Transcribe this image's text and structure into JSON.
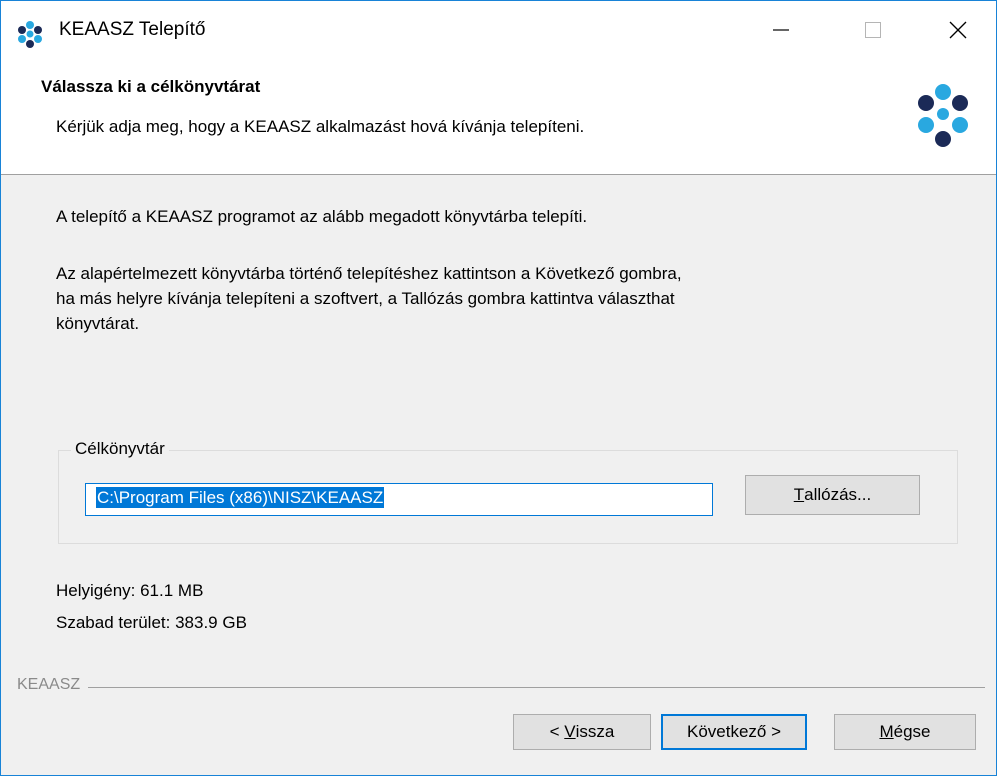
{
  "window": {
    "title": "KEAASZ Telepítő",
    "controls": {
      "minimize": "—",
      "maximize": "☐",
      "close": "✕"
    }
  },
  "header": {
    "title": "Válassza ki a célkönyvtárat",
    "subtitle": "Kérjük adja meg, hogy a KEAASZ alkalmazást hová kívánja telepíteni."
  },
  "body": {
    "paragraph1": "A telepítő a KEAASZ programot az alább megadott könyvtárba telepíti.",
    "paragraph2_line1": "Az alapértelmezett könyvtárba történő telepítéshez kattintson a Következő gombra,",
    "paragraph2_line2": "ha más helyre kívánja telepíteni a szoftvert, a Tallózás gombra kattintva választhat",
    "paragraph2_line3": "könyvtárat."
  },
  "destination": {
    "group_label": "Célkönyvtár",
    "path_value": "C:\\Program Files (x86)\\NISZ\\KEAASZ",
    "browse_prefix": "T",
    "browse_rest": "allózás..."
  },
  "space": {
    "required": "Helyigény: 61.1 MB",
    "free": "Szabad terület: 383.9 GB"
  },
  "footer": {
    "brand": "KEAASZ",
    "back_prefix": "< ",
    "back_ul": "V",
    "back_rest": "issza",
    "next_label": "Következő >",
    "cancel_ul": "M",
    "cancel_rest": "égse"
  },
  "colors": {
    "accent": "#0078d7",
    "logo_light": "#29a8e0",
    "logo_dark": "#1b2a57"
  },
  "icons": {
    "app": "keaasz-logo-icon",
    "header": "keaasz-logo-icon"
  }
}
